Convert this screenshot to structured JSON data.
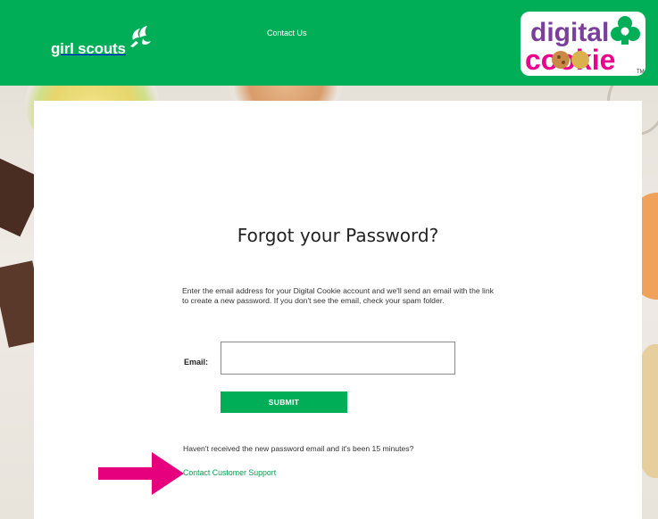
{
  "header": {
    "brand": "girl scouts",
    "contact_link": "Contact Us",
    "dc_logo_top": "digital",
    "dc_logo_bottom": "cookie",
    "bg_color": "#00ae58"
  },
  "form": {
    "title": "Forgot your Password?",
    "description": "Enter the email address for your Digital Cookie account and we'll send an email with the link to create a new password. If you don't see the email, check your spam folder.",
    "email_label": "Email:",
    "email_value": "",
    "submit_label": "SUBMIT",
    "not_received_text": "Haven't received the new password email and it's been 15 minutes?",
    "support_link": "Contact Customer Support"
  },
  "annotation": {
    "arrow_color": "#e6007e"
  }
}
